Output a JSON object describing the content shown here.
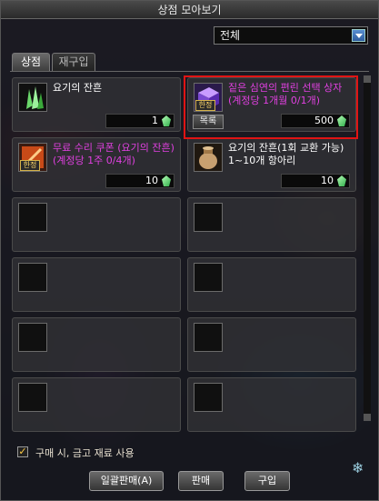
{
  "window": {
    "title": "상점 모아보기"
  },
  "filter": {
    "selected": "전체"
  },
  "tabs": [
    {
      "label": "상점",
      "active": true
    },
    {
      "label": "재구입",
      "active": false
    }
  ],
  "items": [
    {
      "name": "요기의 잔흔",
      "price": "1",
      "name_color": "#ffffff",
      "icon": "green-crystal-icon",
      "limited": false,
      "button": ""
    },
    {
      "name": "짙은 심연의 편린 선택 상자 (계정당 1개월 0/1개)",
      "price": "500",
      "name_color": "#e040e0",
      "icon": "purple-box-icon",
      "limited": true,
      "limited_label": "한정",
      "button": "목록",
      "highlighted": true
    },
    {
      "name": "무료 수리 쿠폰 (요기의 잔흔) (계정당 1주 0/4개)",
      "price": "10",
      "name_color": "#e040e0",
      "icon": "repair-coupon-icon",
      "limited": true,
      "limited_label": "한정",
      "button": ""
    },
    {
      "name": "요기의 잔흔(1회 교환 가능) 1~10개 항아리",
      "price": "10",
      "name_color": "#ffffff",
      "icon": "jar-icon",
      "limited": false,
      "button": ""
    }
  ],
  "options": {
    "use_gold_label": "구매 시, 금고 재료 사용",
    "checked": true
  },
  "buttons": {
    "sell_all": "일괄판매(A)",
    "sell": "판매",
    "buy": "구입"
  },
  "colors": {
    "highlight": "#e01414",
    "price_gem": "#2fae4a",
    "limited_badge": "#ffd86a"
  }
}
